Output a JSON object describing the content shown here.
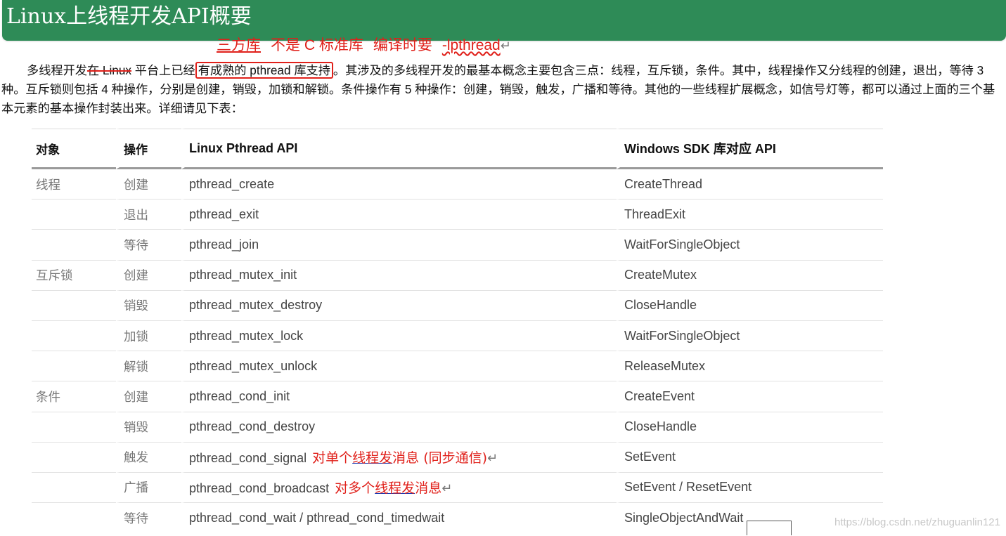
{
  "title": "Linux上线程开发API概要",
  "annotation": {
    "part1": "三方库",
    "part2": "不是 C 标准库",
    "part3": "编译时要",
    "part4": "-lpthread",
    "return_mark": "↵"
  },
  "paragraph": {
    "before_strike": "多线程开发",
    "strike": "在 Linux",
    "middle": " 平台上已经",
    "boxed": "有成熟的 pthread 库支持",
    "after": "。其涉及的多线程开发的最基本概念主要包含三点：线程，互斥锁，条件。其中，线程操作又分线程的创建，退出，等待 3 种。互斥锁则包括 4 种操作，分别是创建，销毁，加锁和解锁。条件操作有 5 种操作：创建，销毁，触发，广播和等待。其他的一些线程扩展概念，如信号灯等，都可以通过上面的三个基本元素的基本操作封装出来。详细请见下表："
  },
  "table": {
    "headers": {
      "object": "对象",
      "operation": "操作",
      "linux": "Linux Pthread API",
      "windows": "Windows SDK 库对应 API"
    },
    "rows": [
      {
        "object": "线程",
        "op": "创建",
        "linux": "pthread_create",
        "note": "",
        "win": "CreateThread"
      },
      {
        "object": "",
        "op": "退出",
        "linux": "pthread_exit",
        "note": "",
        "win": "ThreadExit"
      },
      {
        "object": "",
        "op": "等待",
        "linux": "pthread_join",
        "note": "",
        "win": "WaitForSingleObject"
      },
      {
        "object": "互斥锁",
        "op": "创建",
        "linux": "pthread_mutex_init",
        "note": "",
        "win": "CreateMutex"
      },
      {
        "object": "",
        "op": "销毁",
        "linux": "pthread_mutex_destroy",
        "note": "",
        "win": "CloseHandle"
      },
      {
        "object": "",
        "op": "加锁",
        "linux": "pthread_mutex_lock",
        "note": "",
        "win": "WaitForSingleObject"
      },
      {
        "object": "",
        "op": "解锁",
        "linux": "pthread_mutex_unlock",
        "note": "",
        "win": "ReleaseMutex"
      },
      {
        "object": "条件",
        "op": "创建",
        "linux": "pthread_cond_init",
        "note": "",
        "win": "CreateEvent"
      },
      {
        "object": "",
        "op": "销毁",
        "linux": "pthread_cond_destroy",
        "note": "",
        "win": "CloseHandle"
      },
      {
        "object": "",
        "op": "触发",
        "linux": "pthread_cond_signal",
        "note": "",
        "win": "SetEvent"
      },
      {
        "object": "",
        "op": "广播",
        "linux": "pthread_cond_broadcast",
        "note": "",
        "win": "SetEvent / ResetEvent"
      },
      {
        "object": "",
        "op": "等待",
        "linux": "pthread_cond_wait / pthread_cond_timedwait",
        "note": "",
        "win": "SingleObjectAndWait"
      }
    ],
    "note_signal": {
      "pre": "对单个",
      "ul": "线程发",
      "post": "消息 (同步通信)"
    },
    "note_broadcast": {
      "pre": "对多个",
      "ul": "线程发",
      "post": "消息"
    }
  },
  "watermark": "https://blog.csdn.net/zhuguanlin121"
}
